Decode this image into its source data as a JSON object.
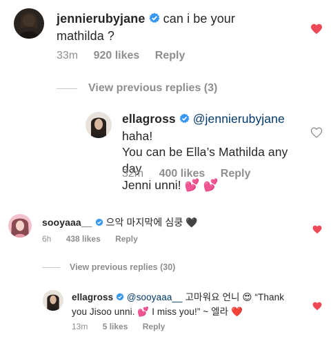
{
  "comment1": {
    "username": "jennierubyjane",
    "text_line1": "can i be your",
    "text_line2": "mathilda ?",
    "time": "33m",
    "likes": "920 likes",
    "reply": "Reply",
    "heart_color": "#ed4956"
  },
  "view_prev_1": {
    "label": "View previous replies (3)"
  },
  "reply1": {
    "username": "ellagross",
    "mention": "@jennierubyjane",
    "text_after_mention": "haha!",
    "text_line2": "You can be Ella’s Mathilda any day",
    "text_line3": "Jenni unni!",
    "emoji": "💕 💕",
    "time": "32m",
    "likes": "400 likes",
    "reply": "Reply"
  },
  "comment2": {
    "username": "sooyaaa__",
    "text": "으악 마지막에 심쿵",
    "emoji": "🖤",
    "time": "6h",
    "likes": "438 likes",
    "reply": "Reply",
    "heart_color": "#ed4956"
  },
  "view_prev_2": {
    "label": "View previous replies (30)"
  },
  "reply2": {
    "username": "ellagross",
    "mention": "@sooyaaa__",
    "text_korean": "고마워요 언니",
    "emoji_smile": "😍",
    "quote_start": "“Thank",
    "line2_a": "you Jisoo unni.",
    "emoji_hearts": "💕",
    "line2_b": "I miss you!” ~ 엘라",
    "emoji_heart": "❤️",
    "time": "13m",
    "likes": "5 likes",
    "reply": "Reply",
    "heart_color": "#ed4956"
  },
  "colors": {
    "text": "#262626",
    "meta": "#8e8e8e",
    "mention": "#00376b",
    "verified": "#3897f0",
    "liked_heart": "#ed4956"
  }
}
